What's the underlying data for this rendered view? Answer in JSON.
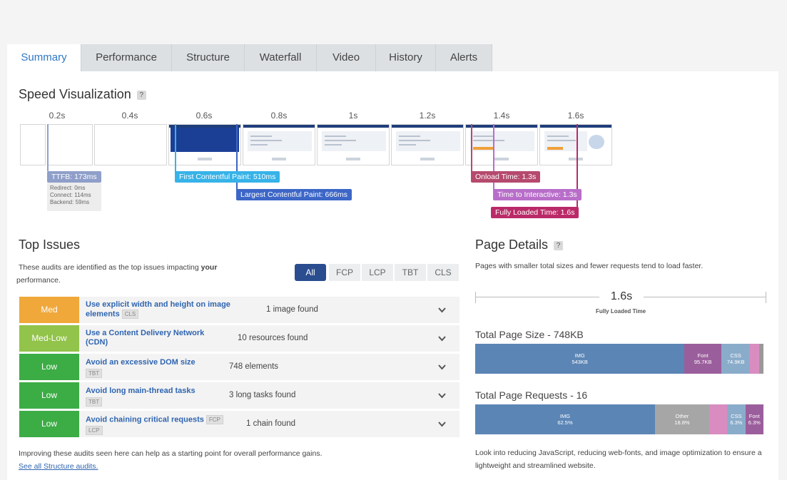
{
  "tabs": [
    "Summary",
    "Performance",
    "Structure",
    "Waterfall",
    "Video",
    "History",
    "Alerts"
  ],
  "speed": {
    "title": "Speed Visualization",
    "help": "?",
    "times": [
      "0.2s",
      "0.4s",
      "0.6s",
      "0.8s",
      "1s",
      "1.2s",
      "1.4s",
      "1.6s"
    ],
    "ttfb": {
      "label": "TTFB: 173ms",
      "redirect": "Redirect: 0ms",
      "connect": "Connect: 114ms",
      "backend": "Backend: 59ms"
    },
    "fcp": "First Contentful Paint: 510ms",
    "lcp": "Largest Contentful Paint: 666ms",
    "onload": "Onload Time: 1.3s",
    "tti": "Time to Interactive: 1.3s",
    "fully": "Fully Loaded Time: 1.6s",
    "colors": {
      "ttfb": "#8f9fc9",
      "fcp": "#36b3e8",
      "lcp": "#3c66c7",
      "onload": "#b54a6d",
      "tti": "#b86ec9",
      "fully": "#bb2a68"
    }
  },
  "issues": {
    "title": "Top Issues",
    "desc_prefix": "These audits are identified as the top issues impacting ",
    "desc_bold": "your",
    "desc_suffix": " performance",
    "desc_end": ".",
    "filters": [
      "All",
      "FCP",
      "LCP",
      "TBT",
      "CLS"
    ],
    "rows": [
      {
        "severity": "Med",
        "color": "#f0a83b",
        "title_line1": "Use explicit width and height on image",
        "title_line2": "elements",
        "tag": "CLS",
        "count": "1 image found"
      },
      {
        "severity": "Med-Low",
        "color": "#92c34a",
        "title_line1": "Use a Content Delivery Network",
        "title_line2": "(CDN)",
        "tag": "",
        "count": "10 resources found"
      },
      {
        "severity": "Low",
        "color": "#3cac45",
        "title_line1": "Avoid an excessive DOM size",
        "title_line2": "",
        "tag": "TBT",
        "count": "748 elements"
      },
      {
        "severity": "Low",
        "color": "#3cac45",
        "title_line1": "Avoid long main-thread tasks",
        "title_line2": "",
        "tag": "TBT",
        "count": "3 long tasks found"
      },
      {
        "severity": "Low",
        "color": "#3cac45",
        "title_line1": "Avoid chaining critical requests",
        "title_line2": "",
        "tag": "FCP",
        "tag2": "LCP",
        "count": "1 chain found"
      }
    ],
    "footer": "Improving these audits seen here can help as a starting point for overall performance gains.",
    "see_all": "See all Structure audits."
  },
  "details": {
    "title": "Page Details",
    "help": "?",
    "desc": "Pages with smaller total sizes and fewer requests tend to load faster.",
    "fully_loaded_value": "1.6s",
    "fully_loaded_label": "Fully Loaded Time",
    "size_title": "Total Page Size - 748KB",
    "size_segments": [
      {
        "name": "IMG",
        "value": "543KB",
        "fraction": 0.726,
        "color": "#5b85b5"
      },
      {
        "name": "Font",
        "value": "95.7KB",
        "fraction": 0.128,
        "color": "#9b5e9c"
      },
      {
        "name": "CSS",
        "value": "74.9KB",
        "fraction": 0.1,
        "color": "#8aaccb"
      },
      {
        "name": "",
        "value": "",
        "fraction": 0.03,
        "color": "#d98cc0"
      },
      {
        "name": "",
        "value": "",
        "fraction": 0.016,
        "color": "#999999"
      }
    ],
    "req_title": "Total Page Requests - 16",
    "req_segments": [
      {
        "name": "IMG",
        "value": "62.5%",
        "fraction": 0.625,
        "color": "#5b85b5"
      },
      {
        "name": "Other",
        "value": "18.8%",
        "fraction": 0.188,
        "color": "#a6a6a6"
      },
      {
        "name": "",
        "value": "",
        "fraction": 0.063,
        "color": "#d98cc0"
      },
      {
        "name": "CSS",
        "value": "6.3%",
        "fraction": 0.063,
        "color": "#8aaccb"
      },
      {
        "name": "Font",
        "value": "6.3%",
        "fraction": 0.063,
        "color": "#9b5e9c"
      }
    ],
    "footer": "Look into reducing JavaScript, reducing web-fonts, and image optimization to ensure a lightweight and streamlined website."
  }
}
